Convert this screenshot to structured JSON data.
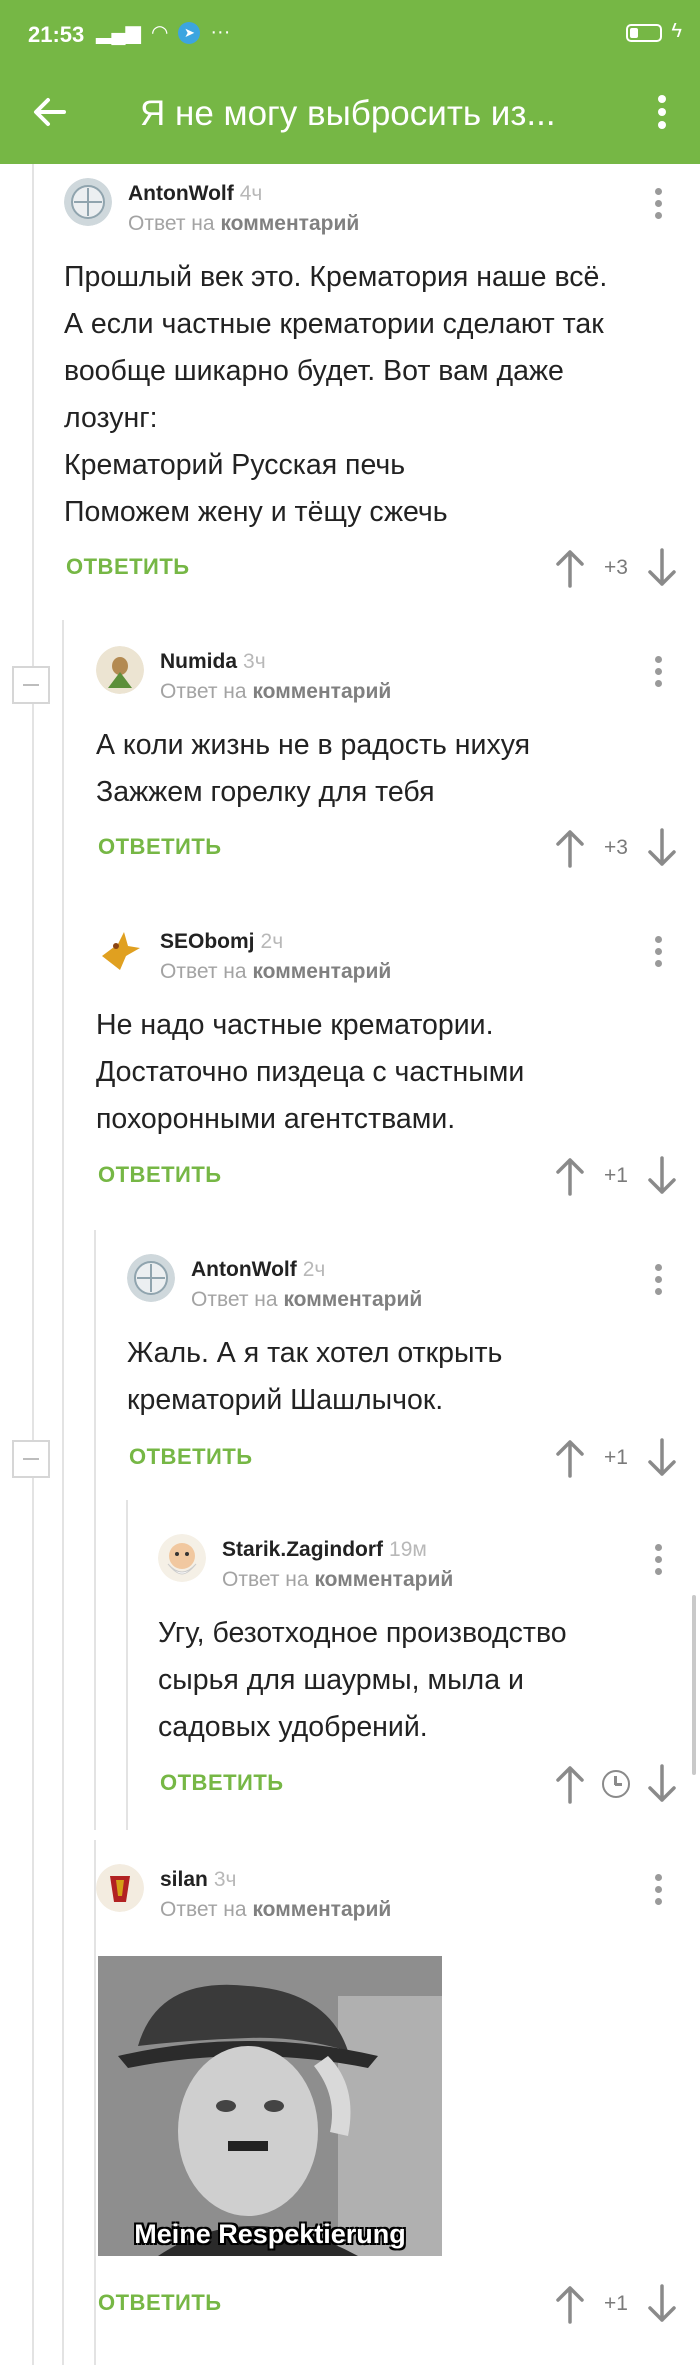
{
  "status": {
    "time": "21:53",
    "icons": [
      "signal-icon",
      "wifi-icon",
      "telegram-icon",
      "more-icon"
    ]
  },
  "appbar": {
    "title": "Я не могу выбросить из..."
  },
  "comments": [
    {
      "user": "AntonWolf",
      "time": "4ч",
      "reply_prefix": "Ответ на",
      "reply_target": "комментарий",
      "lines": [
        "Прошлый век это. Крематория наше всё.",
        "А если частные крематории сделают так",
        "вообще шикарно будет. Вот вам даже",
        "лозунг:",
        "Крематорий Русская печь",
        "Поможем жену и тёщу сжечь"
      ],
      "reply_label": "ОТВЕТИТЬ",
      "rating": "+3"
    },
    {
      "user": "Numida",
      "time": "3ч",
      "reply_prefix": "Ответ на",
      "reply_target": "комментарий",
      "lines": [
        "А коли жизнь не в радость нихуя",
        "Зажжем горелку  для тебя"
      ],
      "reply_label": "ОТВЕТИТЬ",
      "rating": "+3"
    },
    {
      "user": "SEObomj",
      "time": "2ч",
      "reply_prefix": "Ответ на",
      "reply_target": "комментарий",
      "lines": [
        "Не надо частные крематории.",
        "Достаточно пиздеца с частными",
        "похоронными агентствами."
      ],
      "reply_label": "ОТВЕТИТЬ",
      "rating": "+1"
    },
    {
      "user": "AntonWolf",
      "time": "2ч",
      "reply_prefix": "Ответ на",
      "reply_target": "комментарий",
      "lines": [
        "Жаль. А я так хотел открыть",
        "крематорий Шашлычок."
      ],
      "reply_label": "ОТВЕТИТЬ",
      "rating": "+1"
    },
    {
      "user": "Starik.Zagindorf",
      "time": "19м",
      "reply_prefix": "Ответ на",
      "reply_target": "комментарий",
      "lines": [
        "Угу, безотходное производство",
        "сырья для шаурмы, мыла и",
        "садовых удобрений."
      ],
      "reply_label": "ОТВЕТИТЬ",
      "rating_icon": "clock-icon"
    },
    {
      "user": "silan",
      "time": "3ч",
      "reply_prefix": "Ответ на",
      "reply_target": "комментарий",
      "image_caption": "Meine Respektierung",
      "reply_label": "ОТВЕТИТЬ",
      "rating": "+1"
    }
  ],
  "colors": {
    "accent": "#76b745",
    "text": "#222222",
    "muted": "#a3a3a3",
    "thread_line": "#e3e3e3"
  }
}
